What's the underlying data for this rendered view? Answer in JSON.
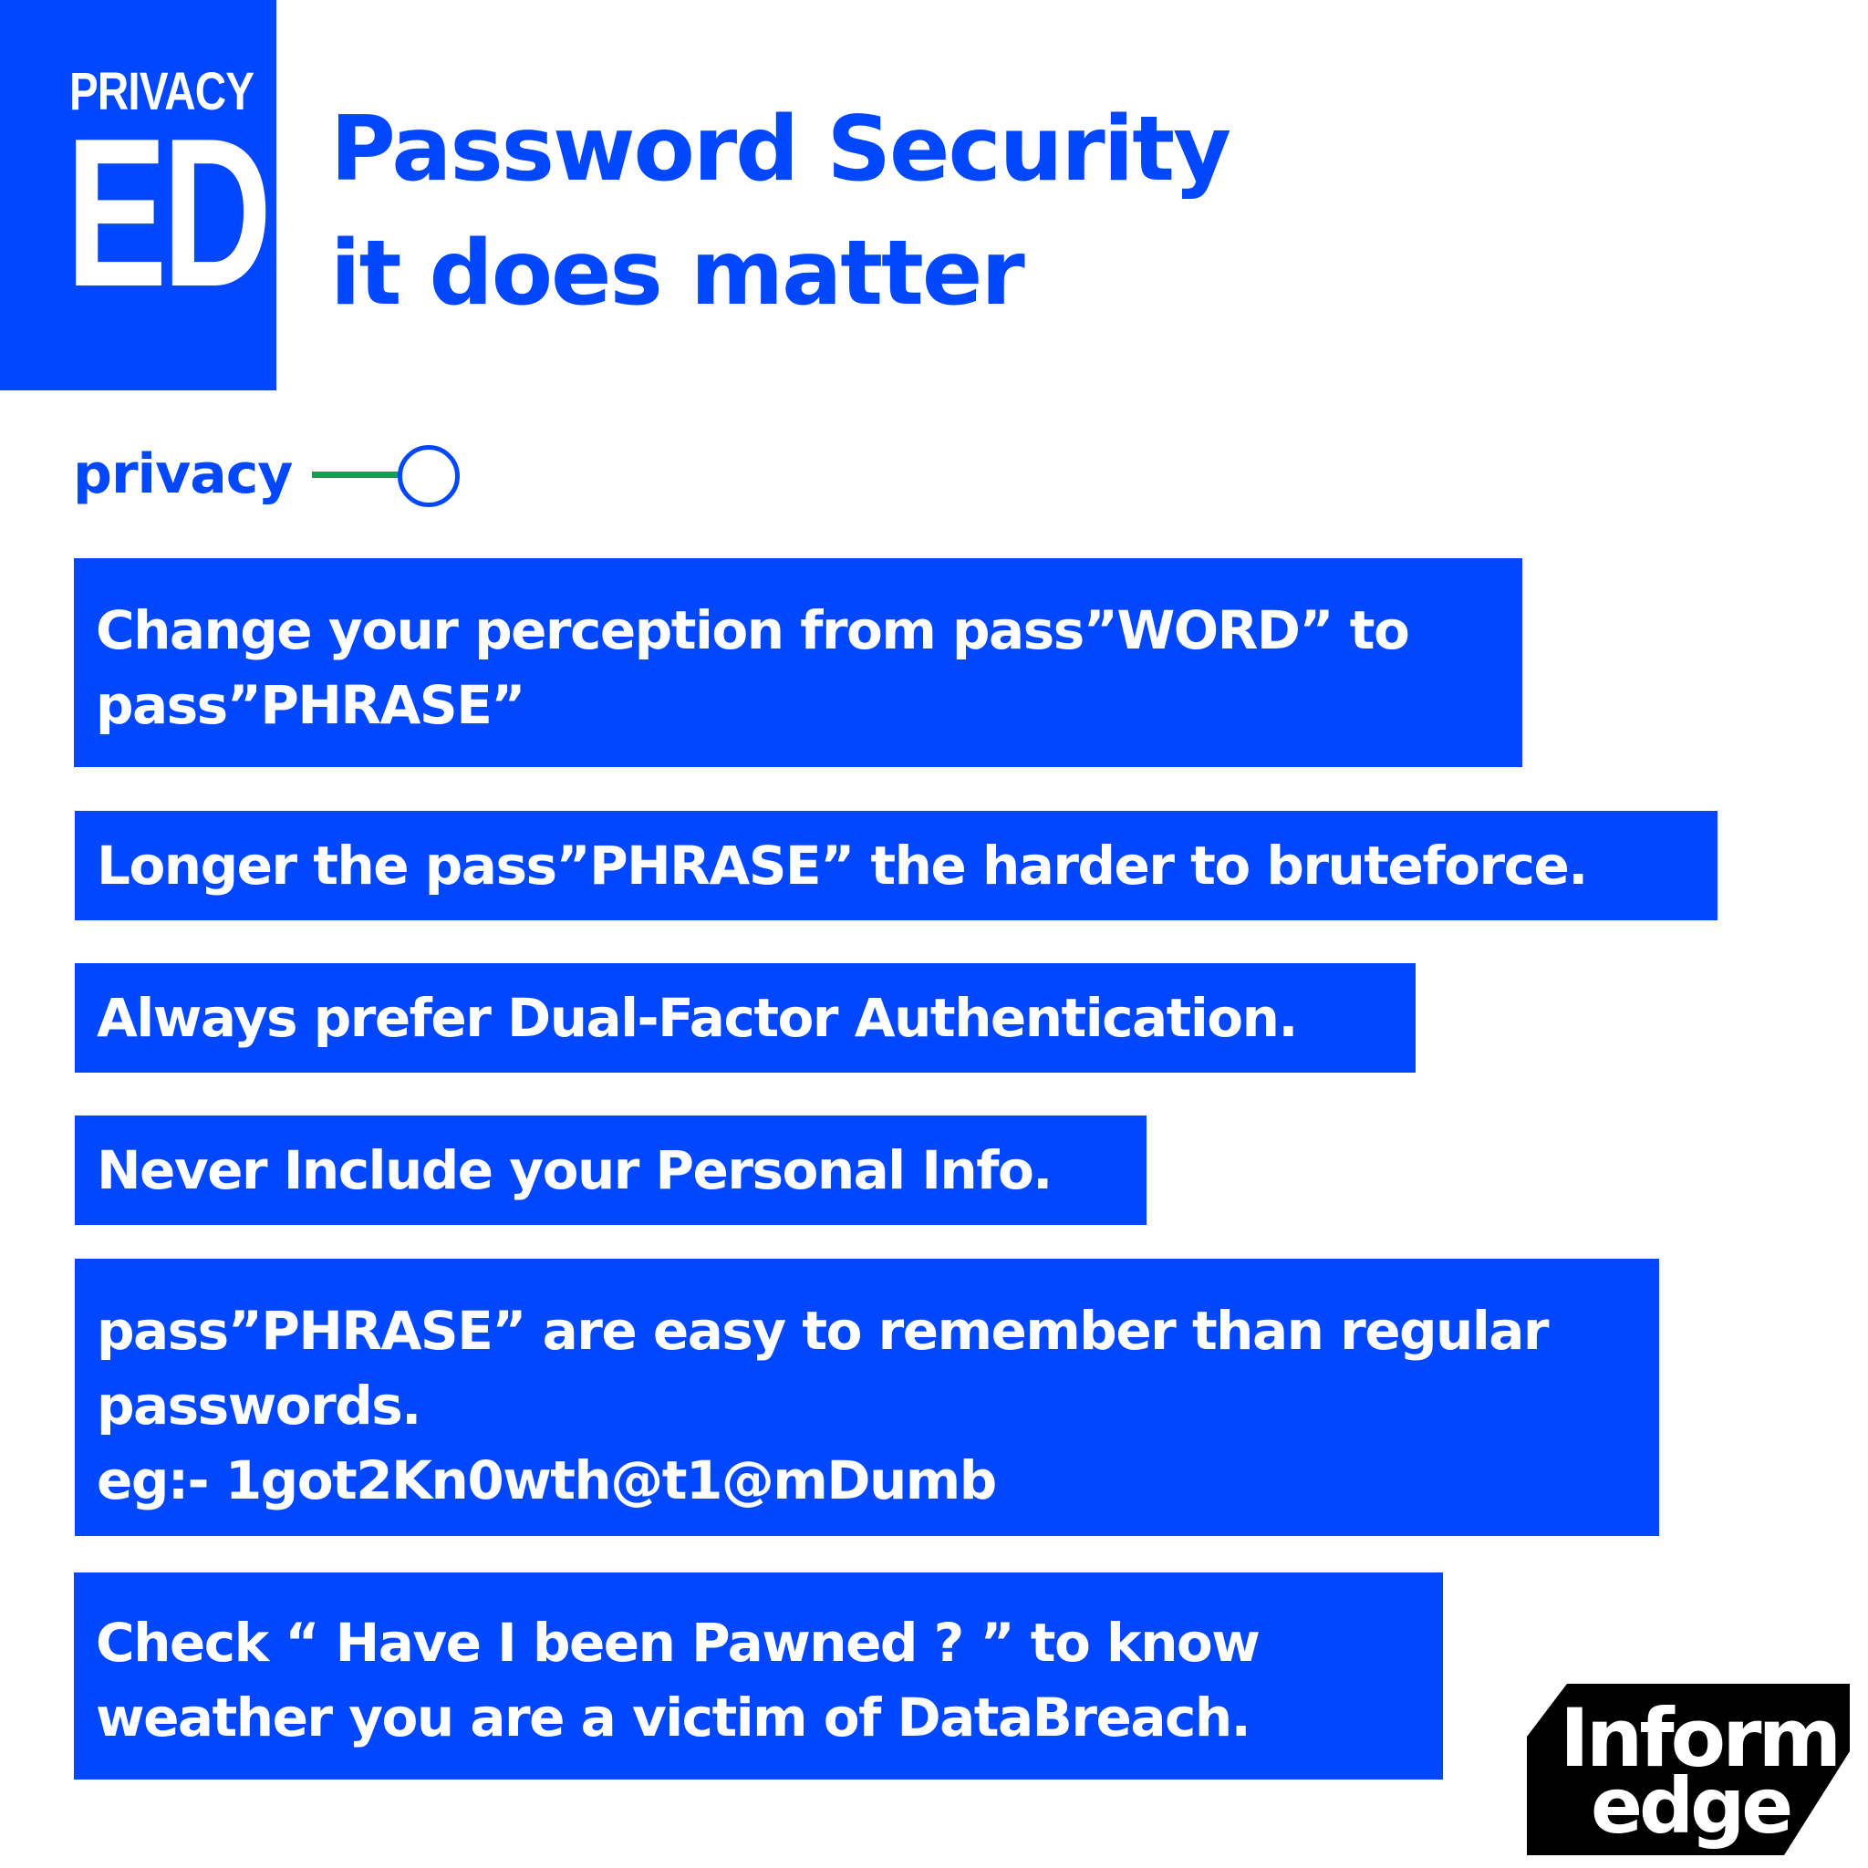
{
  "logo": {
    "top_text": "PRIVACY",
    "big_text": "ED"
  },
  "title": {
    "line1": "Password Security",
    "line2": "it does matter"
  },
  "toggle": {
    "label": "privacy"
  },
  "tips": [
    {
      "lines": [
        "Change your perception from pass”WORD” to",
        "pass”PHRASE”"
      ]
    },
    {
      "lines": [
        "Longer the pass”PHRASE” the harder to bruteforce."
      ]
    },
    {
      "lines": [
        "Always prefer Dual-Factor Authentication."
      ]
    },
    {
      "lines": [
        "Never Include your Personal Info."
      ]
    },
    {
      "lines": [
        "pass”PHRASE” are easy to remember than regular",
        "passwords.",
        "eg:- 1got2Kn0wth@t1@mDumb"
      ]
    },
    {
      "lines": [
        "Check “ Have I been Pawned ? ” to know",
        "weather you are a victim of DataBreach."
      ]
    }
  ],
  "brand": {
    "line1": "Inform",
    "line2": "edge"
  },
  "colors": {
    "primary_blue": "#0047ff",
    "toggle_green": "#12a150",
    "brand_black": "#000000",
    "background": "#ffffff"
  }
}
